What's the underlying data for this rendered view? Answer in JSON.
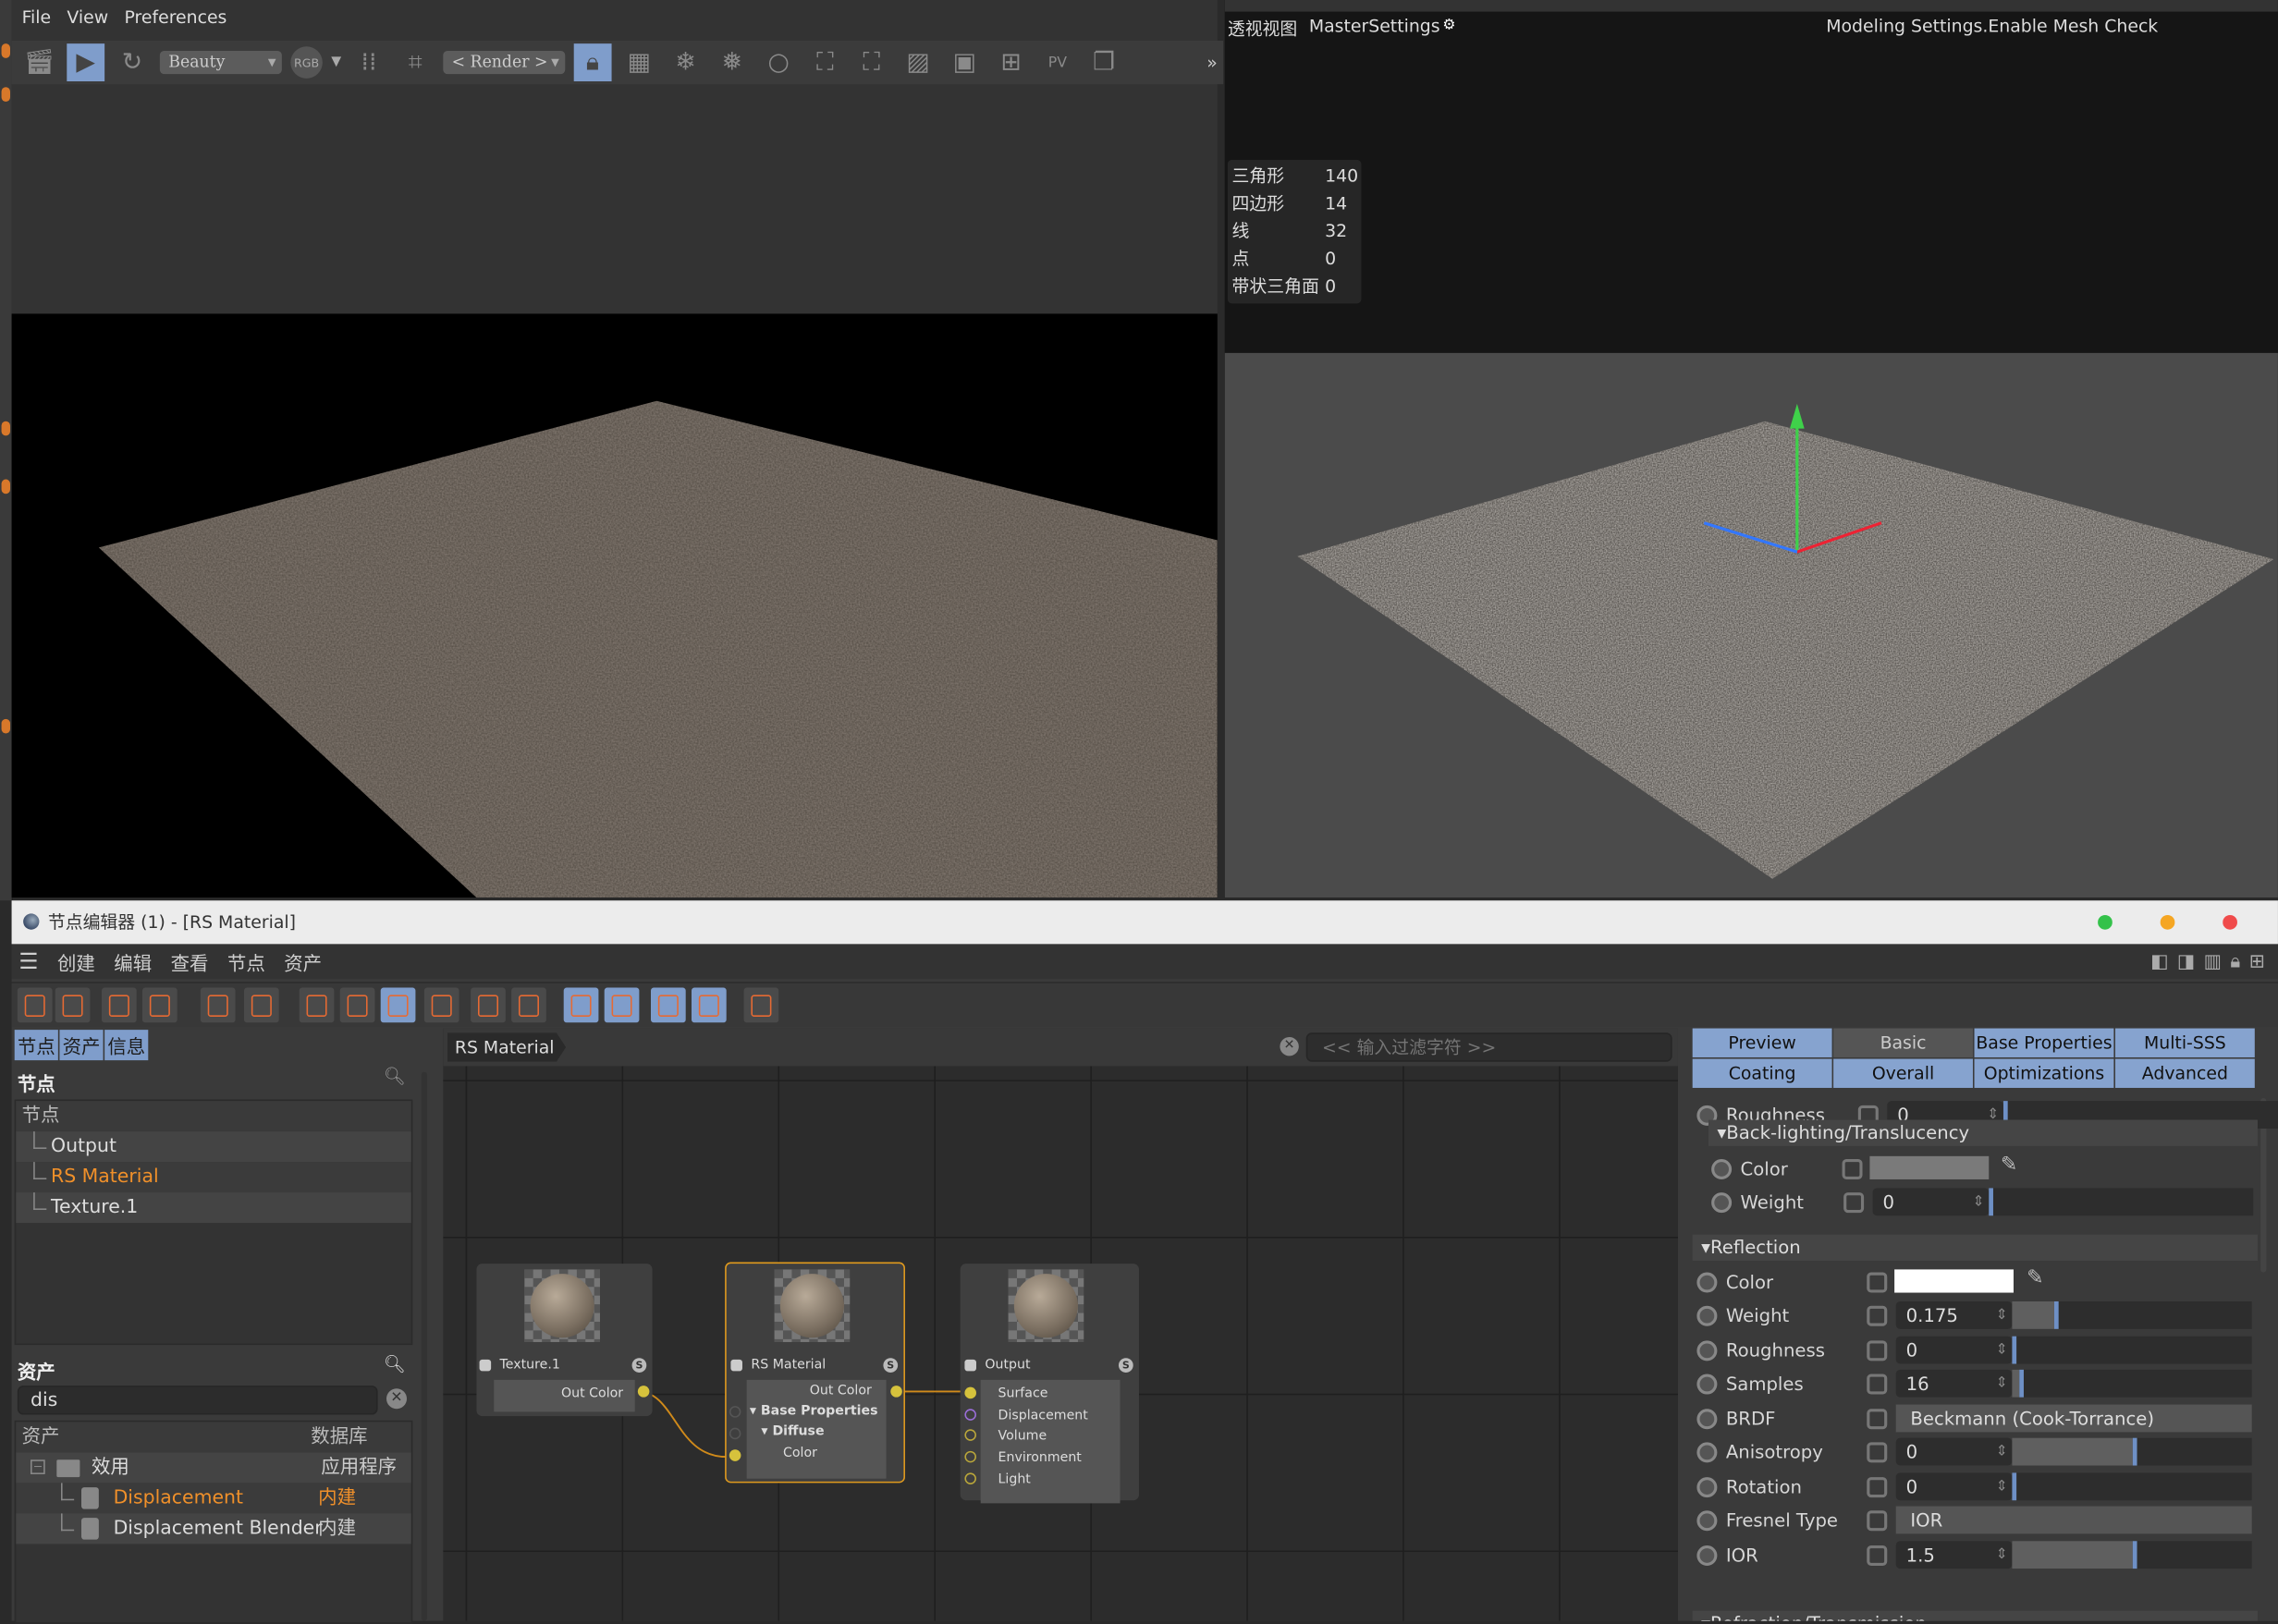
{
  "render_view": {
    "menu": [
      "File",
      "View",
      "Preferences"
    ],
    "pass": "Beauty",
    "channel": "RGB",
    "render_target": "< Render >",
    "overflow": "»"
  },
  "viewport": {
    "view_name": "透视视图",
    "camera": "MasterSettings",
    "overlay": "Modeling Settings.Enable Mesh Check",
    "stats": [
      {
        "label": "三角形",
        "value": "140"
      },
      {
        "label": "四边形",
        "value": "14"
      },
      {
        "label": "线",
        "value": "32"
      },
      {
        "label": "点",
        "value": "0"
      },
      {
        "label": "带状三角面",
        "value": "0"
      }
    ]
  },
  "node_editor": {
    "title": "节点编辑器 (1) - [RS Material]",
    "window_colors": {
      "green": "#34c24a",
      "orange": "#f5a623",
      "red": "#f04b4b"
    },
    "menu": [
      "创建",
      "编辑",
      "查看",
      "节点",
      "资产"
    ],
    "left_tabs": [
      "节点",
      "资产",
      "信息"
    ],
    "nodes_section": {
      "title": "节点",
      "column": "节点",
      "items": [
        {
          "label": "Output",
          "selected": false
        },
        {
          "label": "RS Material",
          "selected": true
        },
        {
          "label": "Texture.1",
          "selected": false
        }
      ]
    },
    "assets_section": {
      "title": "资产",
      "search_value": "dis",
      "columns": [
        "资产",
        "数据库"
      ],
      "rows": [
        {
          "label": "效用",
          "db": "应用程序",
          "type": "folder",
          "highlight": false
        },
        {
          "label": "Displacement",
          "db": "内建",
          "type": "node",
          "highlight": true
        },
        {
          "label": "Displacement Blender",
          "db": "内建",
          "type": "node",
          "highlight": false
        }
      ]
    },
    "graph": {
      "breadcrumb": "RS Material",
      "filter_placeholder": "<< 输入过滤字符 >>",
      "nodes": {
        "texture": {
          "title": "Texture.1",
          "outputs": [
            "Out Color"
          ]
        },
        "material": {
          "title": "RS Material",
          "output": "Out Color",
          "inputs": [
            "Base Properties",
            "Diffuse",
            "Color"
          ]
        },
        "output": {
          "title": "Output",
          "inputs": [
            "Surface",
            "Displacement",
            "Volume",
            "Environment",
            "Light"
          ]
        }
      }
    },
    "attributes": {
      "tabs": [
        {
          "label": "Preview",
          "active": true
        },
        {
          "label": "Basic",
          "active": false
        },
        {
          "label": "Base Properties",
          "active": true
        },
        {
          "label": "Multi-SSS",
          "active": true
        },
        {
          "label": "Coating",
          "active": true
        },
        {
          "label": "Overall",
          "active": true
        },
        {
          "label": "Optimizations",
          "active": true
        },
        {
          "label": "Advanced",
          "active": true
        }
      ],
      "top_roughness": {
        "label": "Roughness",
        "value": "0"
      },
      "backlighting": {
        "title": "Back-lighting/Translucency",
        "color_label": "Color",
        "color": "#7a7a7a",
        "weight_label": "Weight",
        "weight": "0"
      },
      "reflection": {
        "title": "Reflection",
        "color_label": "Color",
        "color": "#ffffff",
        "rows": [
          {
            "label": "Weight",
            "value": "0.175",
            "fill": 0.175,
            "kind": "num"
          },
          {
            "label": "Roughness",
            "value": "0",
            "fill": 0,
            "kind": "num"
          },
          {
            "label": "Samples",
            "value": "16",
            "fill": 0.03,
            "kind": "num"
          },
          {
            "label": "BRDF",
            "value": "Beckmann (Cook-Torrance)",
            "kind": "select"
          },
          {
            "label": "Anisotropy",
            "value": "0",
            "fill": 0.5,
            "kind": "num"
          },
          {
            "label": "Rotation",
            "value": "0",
            "fill": 0,
            "kind": "num"
          },
          {
            "label": "Fresnel Type",
            "value": "IOR",
            "kind": "select"
          },
          {
            "label": "IOR",
            "value": "1.5",
            "fill": 0.5,
            "kind": "num"
          }
        ]
      },
      "refraction": {
        "title": "Refraction/Transmission"
      }
    }
  }
}
